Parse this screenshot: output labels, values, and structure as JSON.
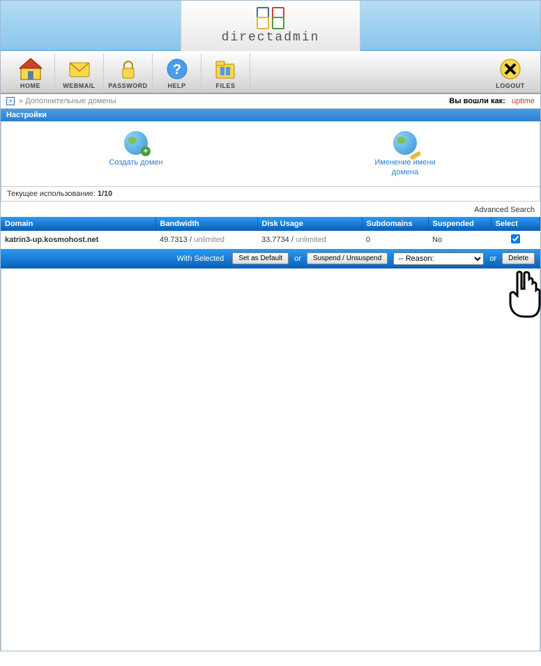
{
  "brand": "directadmin",
  "toolbar": {
    "home": "HOME",
    "webmail": "WEBMAIL",
    "password": "PASSWORD",
    "help": "HELP",
    "files": "FILES",
    "logout": "LOGOUT"
  },
  "breadcrumb": {
    "arrow": "»",
    "page": "Дополнительные домены",
    "logged_as_label": "Вы вошли как:",
    "user": "uptime"
  },
  "section_title": "Настройки",
  "actions": {
    "create": "Создать домен",
    "rename_l1": "Именение имени",
    "rename_l2": "домена"
  },
  "usage": {
    "label": "Текущее использование: ",
    "value": "1/10"
  },
  "adv_search": "Advanced Search",
  "table": {
    "h_domain": "Domain",
    "h_bandwidth": "Bandwidth",
    "h_disk": "Disk Usage",
    "h_sub": "Subdomains",
    "h_susp": "Suspended",
    "h_sel": "Select",
    "row": {
      "domain": "katrin3-up.kosmohost.net",
      "bw_num": "49.7313 / ",
      "bw_unl": "unlimited",
      "disk_num": "33.7734 / ",
      "disk_unl": "unlimited",
      "sub": "0",
      "susp": "No"
    }
  },
  "selrow": {
    "with_selected": "With Selected",
    "set_default": "Set as Default",
    "or1": "or",
    "suspend": "Suspend / Unsuspend",
    "reason": "-- Reason:",
    "or2": "or",
    "delete": "Delete"
  }
}
